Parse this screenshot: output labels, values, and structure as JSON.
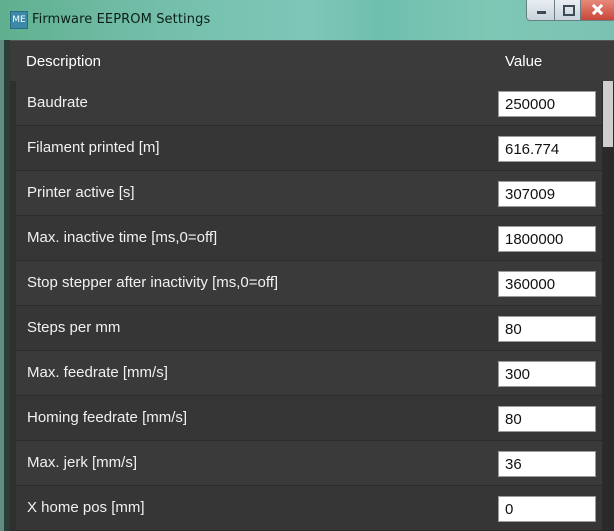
{
  "window": {
    "title": "Firmware EEPROM Settings",
    "icon_label": "ME",
    "buttons": [
      "minimize",
      "maximize",
      "close"
    ]
  },
  "table": {
    "columns": [
      "Description",
      "Value"
    ],
    "rows": [
      {
        "label": "Baudrate",
        "value": "250000"
      },
      {
        "label": "Filament printed [m]",
        "value": "616.774"
      },
      {
        "label": "Printer active [s]",
        "value": "307009"
      },
      {
        "label": "Max. inactive time [ms,0=off]",
        "value": "1800000"
      },
      {
        "label": "Stop stepper after inactivity [ms,0=off]",
        "value": "360000"
      },
      {
        "label": "Steps per mm",
        "value": "80"
      },
      {
        "label": "Max. feedrate [mm/s]",
        "value": "300"
      },
      {
        "label": "Homing feedrate [mm/s]",
        "value": "80"
      },
      {
        "label": "Max. jerk [mm/s]",
        "value": "36"
      },
      {
        "label": "X home pos [mm]",
        "value": "0"
      }
    ]
  },
  "colors": {
    "titlebar": "#78c2b0",
    "header_bg": "#3b3b3b",
    "row_bg": "#3a3a3a",
    "text": "#f1f1f1"
  }
}
